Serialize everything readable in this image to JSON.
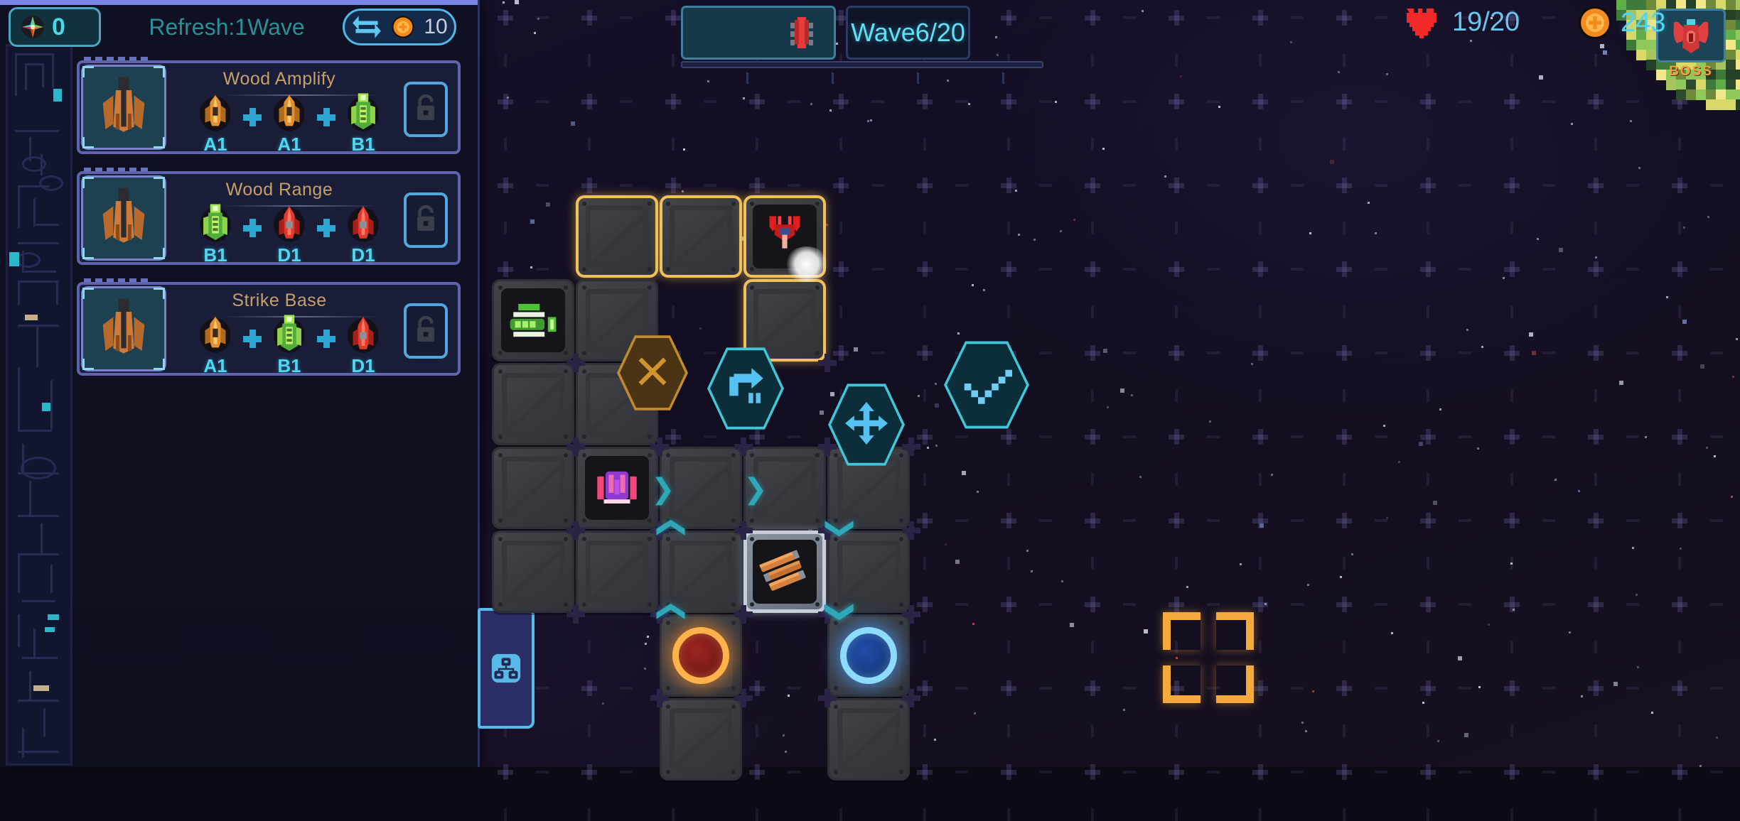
{
  "hud": {
    "gem_icon": "gem-icon",
    "gem_count": "0",
    "refresh_label": "Refresh:1Wave",
    "refresh_icon": "swap-arrows-icon",
    "refresh_cost": "10",
    "wave_icon": "enemy-ship-icon",
    "wave_text": "Wave6/20",
    "boss_icon": "boss-enemy-icon",
    "boss_label": "BOSS",
    "heart_icon": "heart-icon",
    "hp_text": "19/20",
    "coin_icon": "coin-icon",
    "coin_text": "243"
  },
  "sidebar": {
    "cards": [
      {
        "name": "card-wood-amplify",
        "title": "Wood Amplify",
        "portrait_icon": "ship-portrait-icon",
        "lock_icon": "lock-open-icon",
        "recipe": [
          {
            "icon": "ship-a-icon",
            "label": "A1",
            "tier": "a"
          },
          {
            "icon": "ship-a-icon",
            "label": "A1",
            "tier": "a"
          },
          {
            "icon": "ship-b-icon",
            "label": "B1",
            "tier": "b"
          }
        ]
      },
      {
        "name": "card-wood-range",
        "title": "Wood Range",
        "portrait_icon": "ship-portrait-icon",
        "lock_icon": "lock-open-icon",
        "recipe": [
          {
            "icon": "ship-b-icon",
            "label": "B1",
            "tier": "b"
          },
          {
            "icon": "ship-d-icon",
            "label": "D1",
            "tier": "d"
          },
          {
            "icon": "ship-d-icon",
            "label": "D1",
            "tier": "d"
          }
        ]
      },
      {
        "name": "card-strike-base",
        "title": "Strike Base",
        "portrait_icon": "ship-portrait-icon",
        "lock_icon": "lock-open-icon",
        "recipe": [
          {
            "icon": "ship-a-icon",
            "label": "A1",
            "tier": "a"
          },
          {
            "icon": "ship-b-icon",
            "label": "B1",
            "tier": "b"
          },
          {
            "icon": "ship-d-icon",
            "label": "D1",
            "tier": "d"
          }
        ]
      }
    ],
    "tech_tab_icon": "tech-tree-icon"
  },
  "board": {
    "action_buttons": [
      {
        "name": "delete-action-button",
        "icon": "x-icon",
        "color": "#c08b2e"
      },
      {
        "name": "rotate-action-button",
        "icon": "rotate-icon",
        "color": "#41c6d8"
      },
      {
        "name": "move-action-button",
        "icon": "move-arrows-icon",
        "color": "#41c6d8"
      },
      {
        "name": "confirm-action-button",
        "icon": "checkmark-icon",
        "color": "#41c6d8"
      }
    ],
    "units": [
      {
        "name": "unit-green-tower",
        "icon": "green-tower-icon",
        "col": 0,
        "row": 1
      },
      {
        "name": "unit-red-enemy",
        "icon": "red-enemy-icon",
        "col": 2,
        "row": 0
      },
      {
        "name": "unit-pink-tower",
        "icon": "pink-tower-icon",
        "col": 1,
        "row": 3
      },
      {
        "name": "unit-wood-resource",
        "icon": "wood-logs-icon",
        "col": 2,
        "row": 4
      }
    ],
    "portals": [
      {
        "name": "portal-red",
        "color": "#ff8c28",
        "col": 1,
        "row": 5
      },
      {
        "name": "portal-blue",
        "color": "#46a0ff",
        "col": 3,
        "row": 5
      }
    ],
    "placement_bracket": {
      "name": "placement-bracket",
      "color": "#f5a93c"
    }
  },
  "colors": {
    "accent_cyan": "#4fd4f2",
    "accent_gold": "#f0c05a",
    "card_border": "#5d63ad",
    "title_gold": "#c6a06a",
    "boss_orange": "#f2a03c"
  }
}
